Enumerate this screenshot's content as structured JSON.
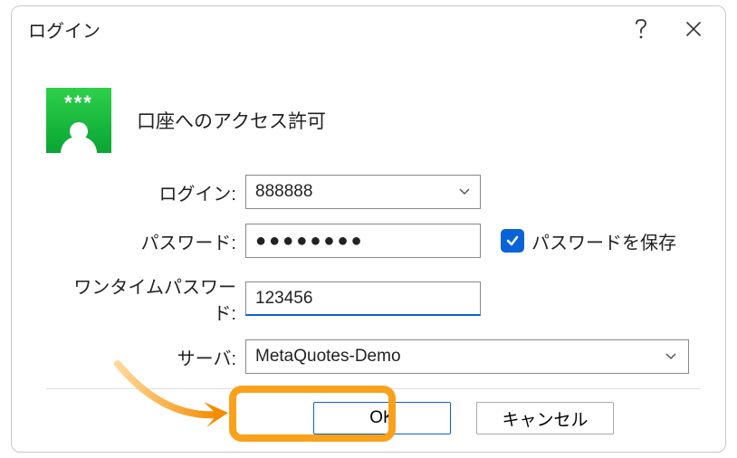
{
  "dialog": {
    "title": "ログイン",
    "heading": "口座へのアクセス許可"
  },
  "form": {
    "login": {
      "label": "ログイン:",
      "value": "888888"
    },
    "password": {
      "label": "パスワード:",
      "value": "●●●●●●●●"
    },
    "save": {
      "label": "パスワードを保存",
      "checked": true
    },
    "otp": {
      "label": "ワンタイムパスワード:",
      "value": "123456"
    },
    "server": {
      "label": "サーバ:",
      "value": "MetaQuotes-Demo"
    }
  },
  "buttons": {
    "ok": "OK",
    "cancel": "キャンセル"
  },
  "icon": {
    "stars": "***"
  }
}
